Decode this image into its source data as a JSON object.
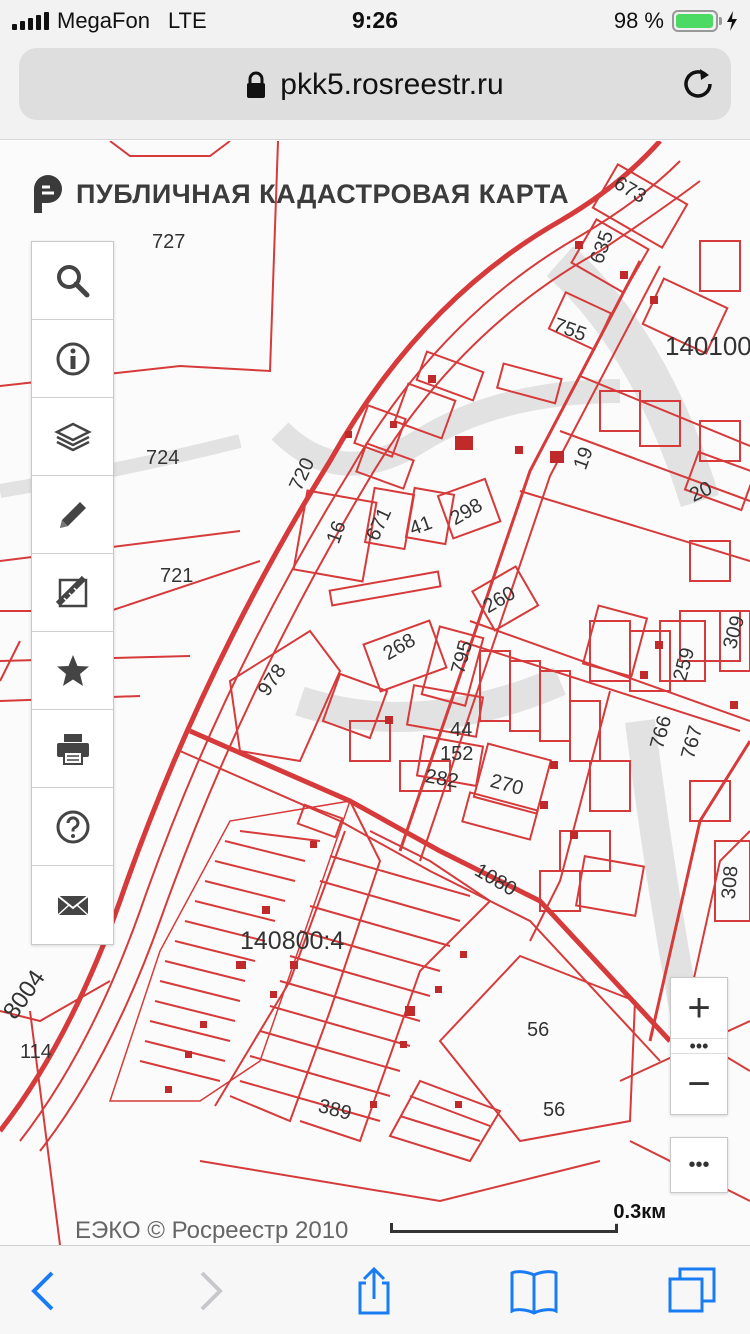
{
  "status_bar": {
    "carrier": "MegaFon",
    "network": "LTE",
    "time": "9:26",
    "battery": "98 %",
    "battery_level": 0.98
  },
  "browser": {
    "url": "pkk5.rosreestr.ru"
  },
  "map": {
    "title": "ПУБЛИЧНАЯ КАДАСТРОВАЯ КАРТА",
    "parcel_labels": [
      "673",
      "635",
      "755",
      "140100",
      "727",
      "724",
      "720",
      "721",
      "16",
      "671",
      "41",
      "298",
      "19",
      "20",
      "260",
      "268",
      "795",
      "978",
      "259",
      "309",
      "44",
      "152",
      "282",
      "270",
      "766",
      "767",
      "1080",
      "308",
      "140800:4",
      "56",
      "56",
      "389",
      "114",
      "8004"
    ],
    "copyright": "ЕЭКО © Росреестр 2010",
    "scale_label": "0.3км",
    "zoom_in": "+",
    "zoom_out": "−",
    "zoom_more": "•••",
    "more": "•••",
    "line_color": "#d63a3a",
    "tools": [
      "search-icon",
      "info-icon",
      "layers-icon",
      "pencil-icon",
      "measure-icon",
      "star-icon",
      "print-icon",
      "help-icon",
      "mail-icon"
    ]
  }
}
